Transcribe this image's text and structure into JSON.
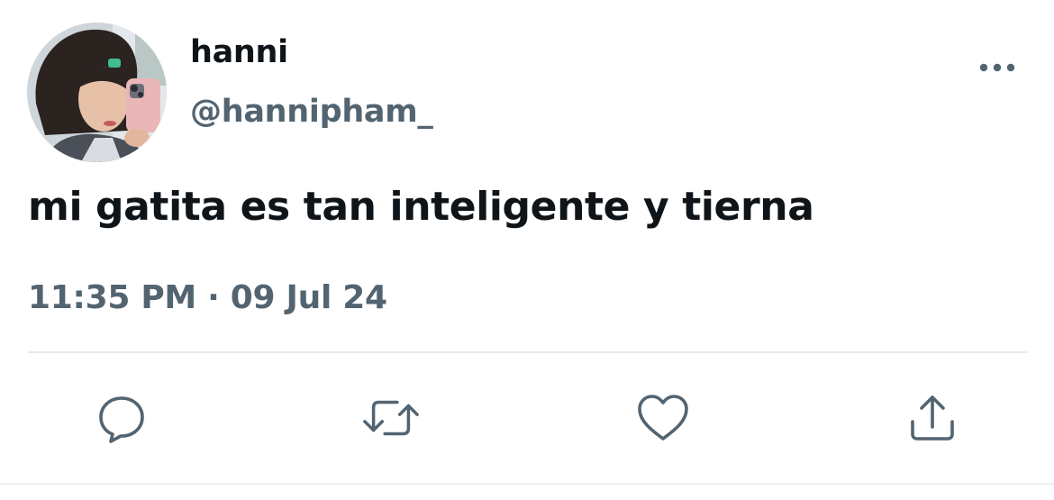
{
  "user": {
    "display_name": "hanni",
    "handle": "@hannipham_",
    "avatar_icon": "profile-photo"
  },
  "tweet": {
    "text": "mi gatita es tan inteligente y tierna",
    "time": "11:35 PM",
    "separator": "·",
    "date": "09 Jul 24"
  },
  "actions": {
    "more_icon": "more-dots-icon",
    "reply_icon": "reply-icon",
    "retweet_icon": "retweet-icon",
    "like_icon": "heart-icon",
    "share_icon": "share-icon"
  },
  "colors": {
    "text_primary": "#0f1419",
    "text_secondary": "#536471",
    "divider": "#e6e9ec"
  }
}
